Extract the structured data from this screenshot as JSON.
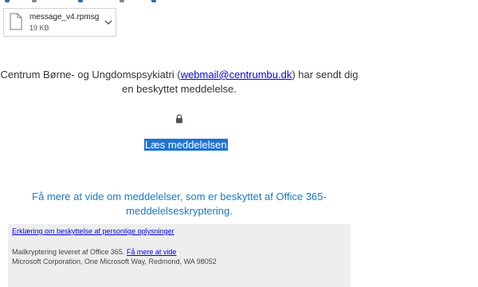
{
  "attachment": {
    "file_name": "message_v4.rpmsg",
    "file_size": "19 KB",
    "icon": "file-icon",
    "menu_icon": "chevron-down-icon"
  },
  "message": {
    "sender_prefix": "Centrum Børne- og Ungdomspsykiatri (",
    "sender_email": "webmail@centrumbu.dk",
    "sender_suffix": ") har sendt dig",
    "sender_line2": "en beskyttet meddelelse.",
    "lock_icon": "lock-icon",
    "read_link": "Læs meddelelsen",
    "learn_more_line1": "Få mere at vide om meddelelser, som er beskyttet af Office 365-",
    "learn_more_line2": "meddelelseskryptering."
  },
  "footer": {
    "privacy_link": "Erklæring om beskyttelse af personlige oplysninger",
    "encryption_text": "Mailkryptering leveret af Office 365. ",
    "encryption_link": "Få mere at vide",
    "address": "Microsoft Corporation, One Microsoft Way, Redmond, WA 98052"
  },
  "colors": {
    "link": "#0000ee",
    "accent": "#1a77c9",
    "highlight": "#1f73d6",
    "footer_bg": "#eeeeee"
  }
}
